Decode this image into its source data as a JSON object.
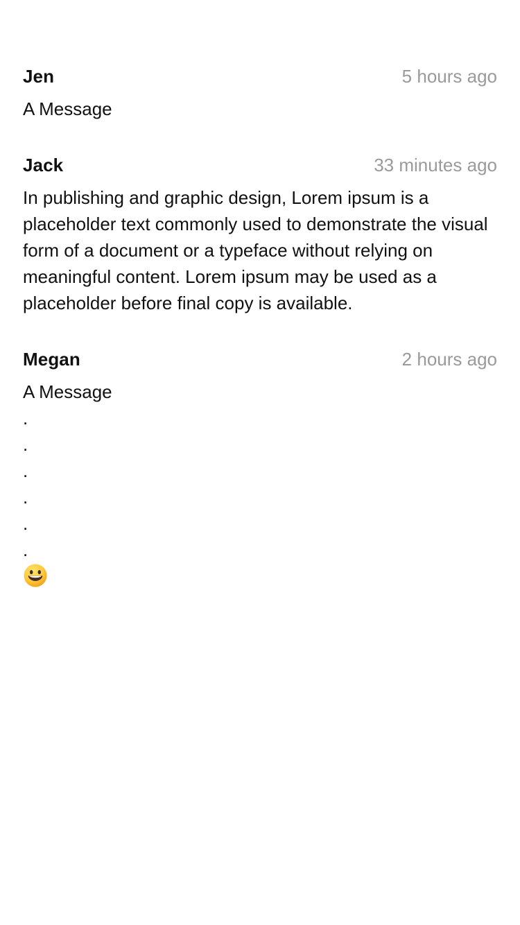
{
  "messages": [
    {
      "author": "Jen",
      "time": "5 hours ago",
      "text": "A Message"
    },
    {
      "author": "Jack",
      "time": "33 minutes ago",
      "text": "In publishing and graphic design, Lorem ipsum is a placeholder text commonly used to demonstrate the visual form of a document or a typeface without relying on meaningful content. Lorem ipsum may be used as a placeholder before final copy is available."
    },
    {
      "author": "Megan",
      "time": "2 hours ago",
      "text": "A Message\n.\n.\n.\n.\n.\n.",
      "emoji": "grinning-face-emoji"
    }
  ]
}
